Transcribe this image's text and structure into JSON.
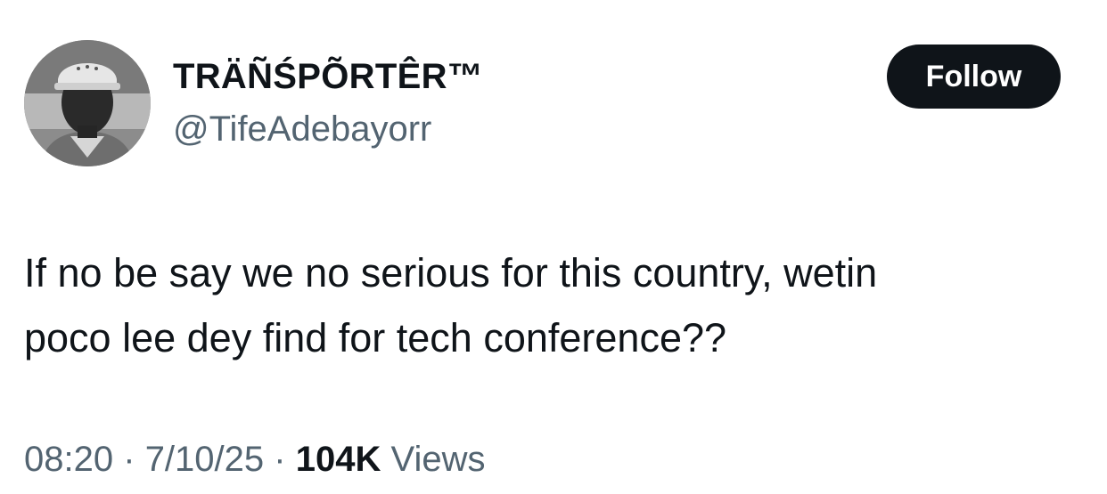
{
  "author": {
    "display_name": "TRÄÑŚPÕRTÊR™",
    "handle": "@TifeAdebayorr"
  },
  "follow_label": "Follow",
  "tweet": {
    "lines": [
      "If no be say we no serious for this country, wetin",
      "poco lee dey find for tech conference??"
    ]
  },
  "meta": {
    "time": "08:20",
    "separator": "·",
    "date": "7/10/25",
    "views_count": "104K",
    "views_label": "Views"
  },
  "colors": {
    "text": "#0f1419",
    "secondary": "#536471",
    "follow_bg": "#0f1419",
    "follow_text": "#ffffff"
  }
}
